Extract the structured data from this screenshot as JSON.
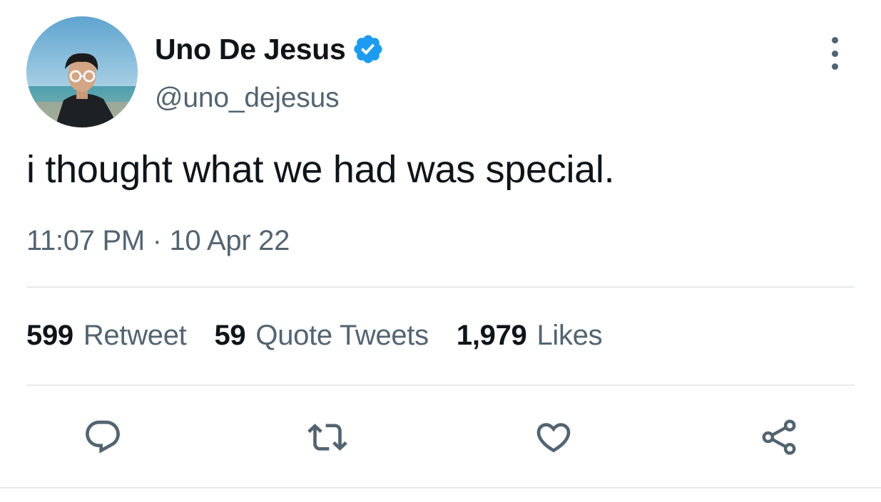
{
  "author": {
    "display_name": "Uno De Jesus",
    "handle": "@uno_dejesus",
    "verified": true,
    "verified_color": "#1d9bf0"
  },
  "tweet": {
    "text": "i thought what we had was special.",
    "timestamp": "11:07 PM · 10 Apr 22"
  },
  "stats": {
    "retweets": {
      "count": "599",
      "label": "Retweet"
    },
    "quotes": {
      "count": "59",
      "label": "Quote Tweets"
    },
    "likes": {
      "count": "1,979",
      "label": "Likes"
    }
  },
  "actions": {
    "icons": [
      "reply-icon",
      "retweet-icon",
      "like-icon",
      "share-icon"
    ],
    "icon_color": "#536471"
  },
  "colors": {
    "text_primary": "#0f1419",
    "text_secondary": "#536471",
    "divider": "#e6eaee"
  }
}
